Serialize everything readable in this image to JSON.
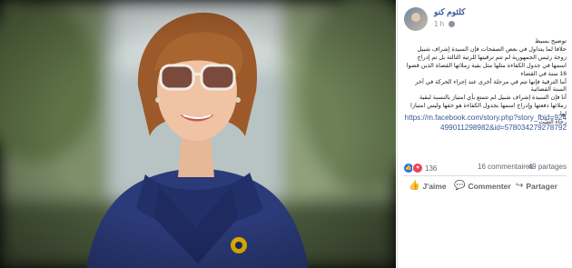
{
  "post": {
    "author": "كلثوم كنو",
    "time": "1 h",
    "body": [
      "توضيح بسيط",
      "حلافا لما يتداول في بعض الصفحات فإن السيدة إشراف شبيل زوجة رئيس الجمهورية لم تتم ترقيتها للرتبة الثالثة بل تم إدراج اسمها في جدول الكفاءة مثلها مثل بقية زملائها القضاة الذين قضوا 16 سنة في القضاء",
      "أما الترقية فإنها تتم في مرحلة أخرى عند إجراء الحركة في آخر السنة القضائية",
      "أنا فإن السيدة إشراف شبيل لم تتمتع بأي امتياز بالنسبة لبقية زملائها دفعتها وإدراج اسمها بجدول الكفاءة هو حقها وليس امتيازا لها",
      "رجاء التثبّت"
    ],
    "link": "https://m.facebook.com/story.php?story_fbid=924499011298982&id=578034279278792"
  },
  "reactions": {
    "icons": [
      "like-icon",
      "love-icon"
    ],
    "count": "136",
    "comments": "16 commentaires",
    "shares": "49 partages"
  },
  "actions": {
    "like": "J'aime",
    "comment": "Commenter",
    "share": "Partager"
  },
  "colors": {
    "link": "#385898",
    "author": "#365899",
    "like": "#1877f2",
    "love": "#f33e58"
  }
}
